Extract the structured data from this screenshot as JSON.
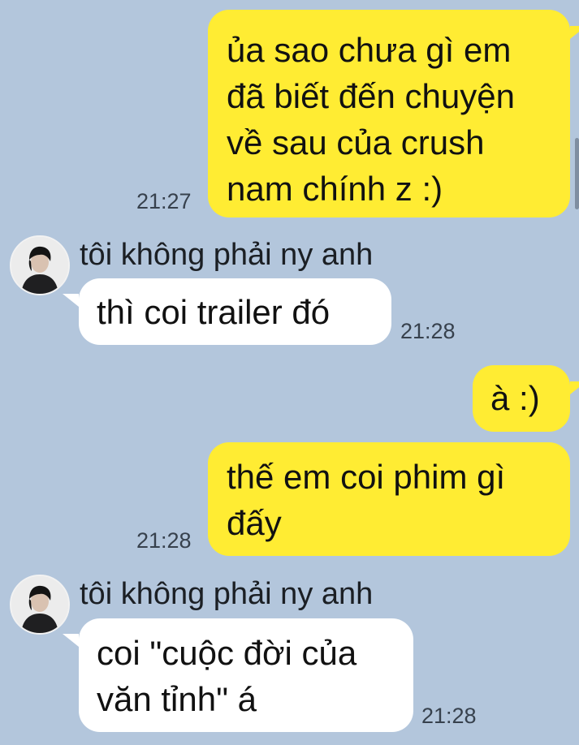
{
  "theme": {
    "background": "#b3c6dc",
    "outgoing_bubble": "#ffec33",
    "incoming_bubble": "#ffffff"
  },
  "messages": [
    {
      "direction": "out",
      "text": "ủa sao chưa gì em\nđã biết đến chuyện\nvề sau của crush\nnam chính z :)",
      "time": "21:27"
    },
    {
      "direction": "in",
      "sender": "tôi không phải ny anh",
      "avatar": "profile-photo",
      "text": "thì coi trailer đó",
      "time": "21:28"
    },
    {
      "direction": "out",
      "text": "à :)",
      "time": ""
    },
    {
      "direction": "out",
      "text": "thế em coi phim gì\nđấy",
      "time": "21:28"
    },
    {
      "direction": "in",
      "sender": "tôi không phải ny anh",
      "avatar": "profile-photo",
      "text": "coi \"cuộc đời của\nvăn tỉnh\" á",
      "time": "21:28"
    }
  ]
}
